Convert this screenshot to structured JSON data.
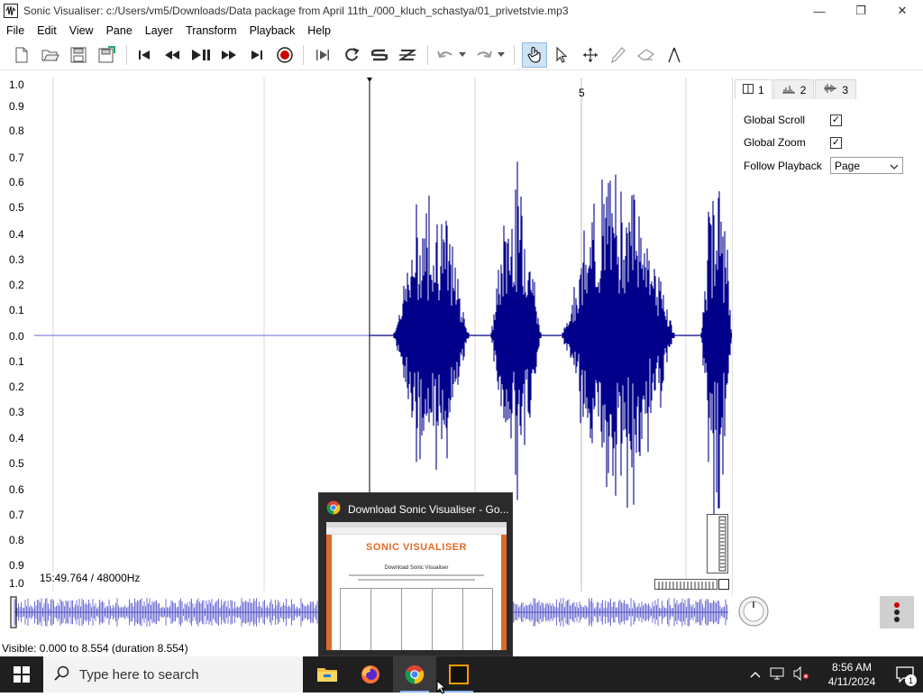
{
  "window": {
    "title": "Sonic Visualiser: c:/Users/vm5/Downloads/Data package from April 11th_/000_kluch_schastya/01_privetstvie.mp3",
    "minimize": "—",
    "maximize": "❐",
    "close": "✕"
  },
  "menu": [
    "File",
    "Edit",
    "View",
    "Pane",
    "Layer",
    "Transform",
    "Playback",
    "Help"
  ],
  "toolbar_icons": [
    "new-file-icon",
    "open-file-icon",
    "save-icon",
    "save-session-icon",
    "rewind-start-icon",
    "rewind-icon",
    "play-pause-icon",
    "fast-forward-icon",
    "forward-end-icon",
    "record-icon",
    "play-selection-icon",
    "loop-icon",
    "solo-icon",
    "align-icon",
    "undo-icon",
    "redo-icon",
    "navigate-icon",
    "select-icon",
    "move-icon",
    "draw-icon",
    "erase-icon",
    "measure-icon"
  ],
  "pane": {
    "scale_ticks": [
      "1.0",
      "0.9",
      "0.8",
      "0.7",
      "0.6",
      "0.5",
      "0.4",
      "0.3",
      "0.2",
      "0.1",
      "0.0",
      "0.1",
      "0.2",
      "0.3",
      "0.4",
      "0.5",
      "0.6",
      "0.7",
      "0.8",
      "0.9",
      "1.0"
    ],
    "time_marker": "5",
    "info": "15:49.764 / 48000Hz",
    "wave_color": "#00008b",
    "overview_color": "#6f6fd6"
  },
  "right_panel": {
    "tabs": [
      {
        "label": "1",
        "icon": "pane-icon"
      },
      {
        "label": "2",
        "icon": "spectrum-icon"
      },
      {
        "label": "3",
        "icon": "waveform-icon"
      }
    ],
    "global_scroll": {
      "label": "Global Scroll",
      "checked": "✓"
    },
    "global_zoom": {
      "label": "Global Zoom",
      "checked": "✓"
    },
    "follow_playback": {
      "label": "Follow Playback",
      "value": "Page"
    }
  },
  "status": "Visible: 0.000 to 8.554 (duration 8.554)",
  "popup": {
    "title": "Download Sonic Visualiser - Go...",
    "thumb_heading": "SONIC VISUALISER",
    "thumb_sub": "Download Sonic Visualiser"
  },
  "taskbar": {
    "search_placeholder": "Type here to search",
    "time": "8:56 AM",
    "date": "4/11/2024",
    "notif_count": "1"
  }
}
